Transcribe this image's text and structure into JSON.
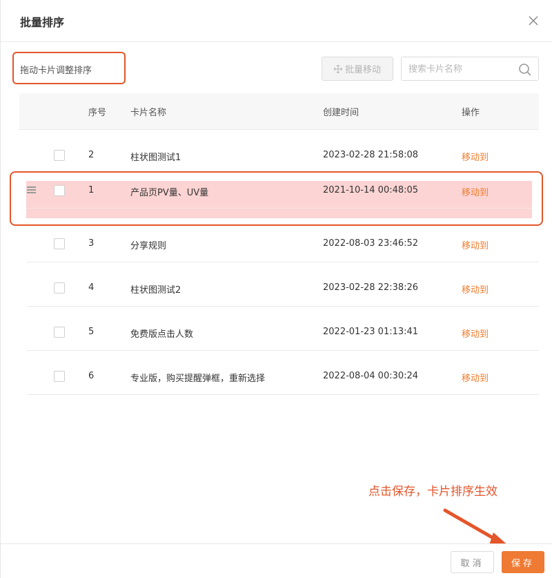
{
  "dialog": {
    "title": "批量排序",
    "close_icon": "close-icon"
  },
  "toolbar": {
    "hint": "拖动卡片调整排序",
    "batch_move_label": "批量移动",
    "batch_move_icon": "move-icon",
    "search_placeholder": "搜索卡片名称",
    "search_icon": "search-icon"
  },
  "table": {
    "columns": [
      "序号",
      "卡片名称",
      "创建时间",
      "操作"
    ],
    "rows": [
      {
        "index": "2",
        "name": "柱状图测试1",
        "created": "2023-02-28 21:58:08",
        "action": "移动到"
      },
      {
        "index": "1",
        "name": "产品页PV量、UV量",
        "created": "2021-10-14 00:48:05",
        "action": "移动到",
        "dragging": true
      },
      {
        "index": "3",
        "name": "分享规则",
        "created": "2022-08-03 23:46:52",
        "action": "移动到"
      },
      {
        "index": "4",
        "name": "柱状图测试2",
        "created": "2023-02-28 22:38:26",
        "action": "移动到"
      },
      {
        "index": "5",
        "name": "免费版点击人数",
        "created": "2022-01-23 01:13:41",
        "action": "移动到"
      },
      {
        "index": "6",
        "name": "专业版，购买提醒弹框，重新选择",
        "created": "2022-08-04 00:30:24",
        "action": "移动到"
      }
    ]
  },
  "annotation": {
    "text": "点击保存，卡片排序生效",
    "color": "#e4552a"
  },
  "footer": {
    "cancel_label": "取消",
    "save_label": "保存"
  },
  "colors": {
    "accent": "#ef7a33",
    "link": "#f07c2d",
    "highlight": "#fbd4d3"
  }
}
